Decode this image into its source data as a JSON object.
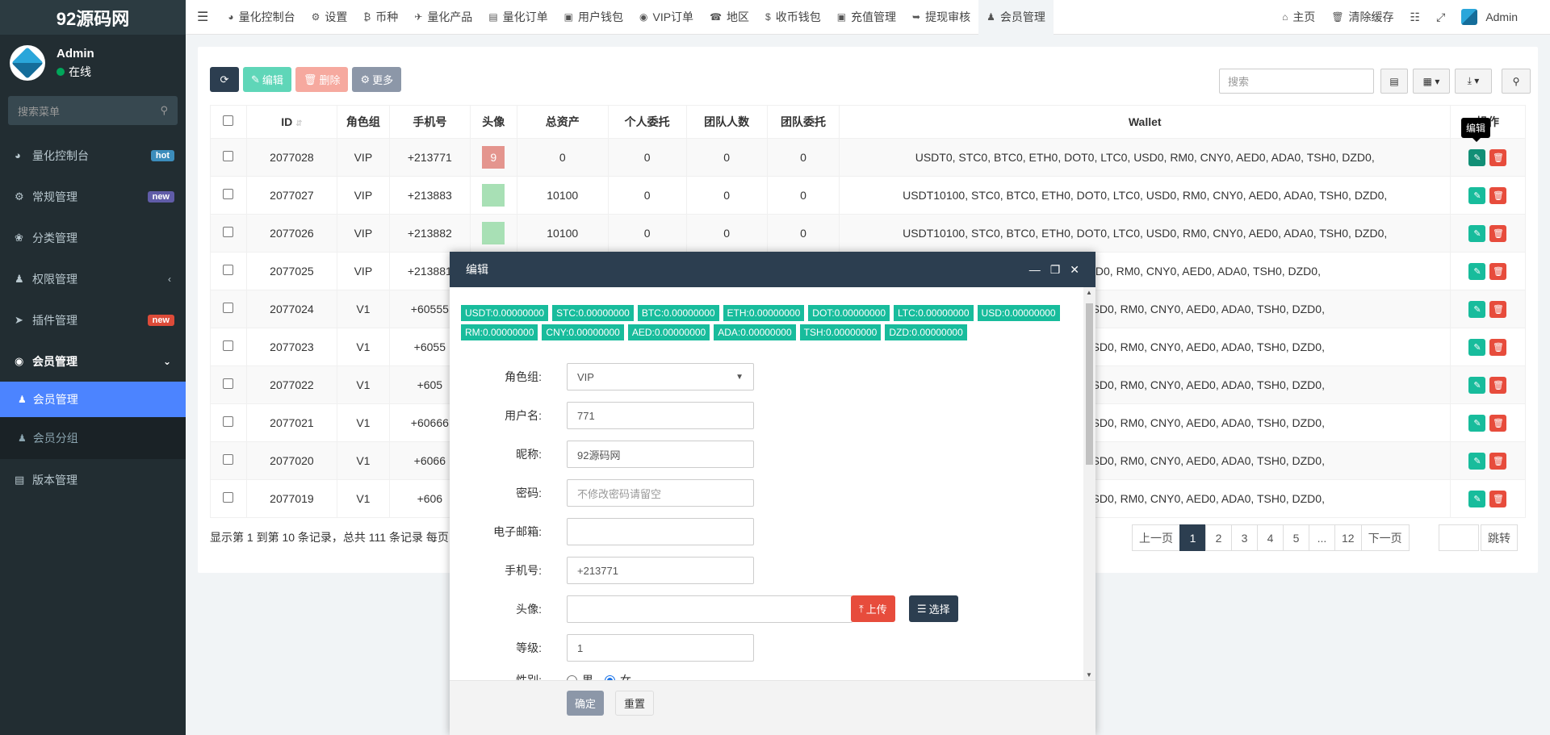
{
  "sidebar": {
    "logo": "92源码网",
    "user": "Admin",
    "status": "在线",
    "search_placeholder": "搜索菜单",
    "items": [
      {
        "label": "量化控制台",
        "badge": "hot"
      },
      {
        "label": "常规管理",
        "badge": "new"
      },
      {
        "label": "分类管理"
      },
      {
        "label": "权限管理"
      },
      {
        "label": "插件管理",
        "badge": "new"
      },
      {
        "label": "会员管理"
      }
    ],
    "sub_active": "会员管理",
    "sub_item": "会员分组",
    "last": "版本管理"
  },
  "topbar": {
    "tabs": [
      "量化控制台",
      "设置",
      "币种",
      "量化产品",
      "量化订单",
      "用户钱包",
      "VIP订单",
      "地区",
      "收币钱包",
      "充值管理",
      "提现审核",
      "会员管理"
    ],
    "home": "主页",
    "clear": "清除缓存",
    "admin": "Admin"
  },
  "toolbar": {
    "edit": "编辑",
    "delete": "删除",
    "more": "更多",
    "search_placeholder": "搜索"
  },
  "table": {
    "headers": [
      "ID",
      "角色组",
      "手机号",
      "头像",
      "总资产",
      "个人委托",
      "团队人数",
      "团队委托",
      "Wallet",
      "操作"
    ],
    "rows": [
      {
        "id": "2077028",
        "role": "VIP",
        "phone": "+213771",
        "avatar": "9",
        "assets": "0",
        "personal": "0",
        "team": "0",
        "team_order": "0",
        "wallet": "USDT0, STC0, BTC0, ETH0, DOT0, LTC0, USD0, RM0, CNY0, AED0, ADA0, TSH0, DZD0,"
      },
      {
        "id": "2077027",
        "role": "VIP",
        "phone": "+213883",
        "avatar": "",
        "assets": "10100",
        "personal": "0",
        "team": "0",
        "team_order": "0",
        "wallet": "USDT10100, STC0, BTC0, ETH0, DOT0, LTC0, USD0, RM0, CNY0, AED0, ADA0, TSH0, DZD0,"
      },
      {
        "id": "2077026",
        "role": "VIP",
        "phone": "+213882",
        "avatar": "",
        "assets": "10100",
        "personal": "0",
        "team": "0",
        "team_order": "0",
        "wallet": "USDT10100, STC0, BTC0, ETH0, DOT0, LTC0, USD0, RM0, CNY0, AED0, ADA0, TSH0, DZD0,"
      },
      {
        "id": "2077025",
        "role": "VIP",
        "phone": "+213881",
        "wallet": "LTC0, USD0, RM0, CNY0, AED0, ADA0, TSH0, DZD0,"
      },
      {
        "id": "2077024",
        "role": "V1",
        "phone": "+60555",
        "wallet": "DT0, LTC0, USD0, RM0, CNY0, AED0, ADA0, TSH0, DZD0,"
      },
      {
        "id": "2077023",
        "role": "V1",
        "phone": "+6055",
        "wallet": "DT0, LTC0, USD0, RM0, CNY0, AED0, ADA0, TSH0, DZD0,"
      },
      {
        "id": "2077022",
        "role": "V1",
        "phone": "+605",
        "wallet": "DT0, LTC0, USD0, RM0, CNY0, AED0, ADA0, TSH0, DZD0,"
      },
      {
        "id": "2077021",
        "role": "V1",
        "phone": "+60666",
        "wallet": "DT0, LTC0, USD0, RM0, CNY0, AED0, ADA0, TSH0, DZD0,"
      },
      {
        "id": "2077020",
        "role": "V1",
        "phone": "+6066",
        "wallet": "DT0, LTC0, USD0, RM0, CNY0, AED0, ADA0, TSH0, DZD0,"
      },
      {
        "id": "2077019",
        "role": "V1",
        "phone": "+606",
        "wallet": "DT0, LTC0, USD0, RM0, CNY0, AED0, ADA0, TSH0, DZD0,"
      }
    ]
  },
  "tooltip": "编辑",
  "pagination": {
    "info": "显示第 1 到第 10 条记录，总共 111 条记录 每页",
    "prev": "上一页",
    "pages": [
      "1",
      "2",
      "3",
      "4",
      "5",
      "...",
      "12"
    ],
    "next": "下一页",
    "jump": "跳转"
  },
  "modal": {
    "title": "编辑",
    "tags": [
      "USDT:0.00000000",
      "STC:0.00000000",
      "BTC:0.00000000",
      "ETH:0.00000000",
      "DOT:0.00000000",
      "LTC:0.00000000",
      "USD:0.00000000",
      "RM:0.00000000",
      "CNY:0.00000000",
      "AED:0.00000000",
      "ADA:0.00000000",
      "TSH:0.00000000",
      "DZD:0.00000000"
    ],
    "fields": {
      "role_label": "角色组:",
      "role_value": "VIP",
      "username_label": "用户名:",
      "username_value": "771",
      "nickname_label": "昵称:",
      "nickname_value": "92源码网",
      "password_label": "密码:",
      "password_placeholder": "不修改密码请留空",
      "email_label": "电子邮箱:",
      "phone_label": "手机号:",
      "phone_value": "+213771",
      "avatar_label": "头像:",
      "upload": "上传",
      "choose": "选择",
      "level_label": "等级:",
      "level_value": "1",
      "gender_label": "性别:",
      "male": "男",
      "female": "女"
    },
    "ok": "确定",
    "reset": "重置"
  },
  "colors": {
    "sidebar": "#222d32",
    "accent": "#4c84ff",
    "green": "#18bc9c",
    "red": "#e74c3c",
    "navy": "#2c3e50"
  }
}
